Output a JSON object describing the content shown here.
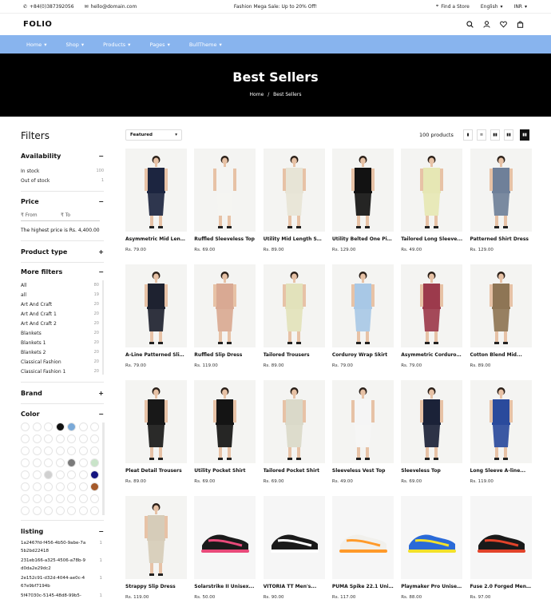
{
  "topbar": {
    "phone": "+84(0)387392056",
    "email": "hello@domain.com",
    "promo": "Fashion Mega Sale: Up to 20% Off!",
    "store": "Find a Store",
    "language": "English",
    "currency": "INR"
  },
  "brand": {
    "logo": "FOLIO"
  },
  "nav": [
    {
      "label": "Home"
    },
    {
      "label": "Shop"
    },
    {
      "label": "Products"
    },
    {
      "label": "Pages"
    },
    {
      "label": "BullTheme"
    }
  ],
  "hero": {
    "title": "Best Sellers",
    "crumb_home": "Home",
    "crumb_sep": "/",
    "crumb_current": "Best Sellers"
  },
  "filters": {
    "title": "Filters",
    "availability": {
      "label": "Availability",
      "items": [
        {
          "label": "In stock",
          "count": "100"
        },
        {
          "label": "Out of stock",
          "count": "1"
        }
      ]
    },
    "price": {
      "label": "Price",
      "from": "₹ From",
      "to": "₹ To",
      "note": "The highest price is Rs. 4,400.00"
    },
    "product_type": {
      "label": "Product type"
    },
    "more": {
      "label": "More filters",
      "items": [
        {
          "label": "All",
          "count": "80"
        },
        {
          "label": "all",
          "count": "19"
        },
        {
          "label": "Art And Craft",
          "count": "20"
        },
        {
          "label": "Art And Craft 1",
          "count": "20"
        },
        {
          "label": "Art And Craft 2",
          "count": "20"
        },
        {
          "label": "Blankets",
          "count": "20"
        },
        {
          "label": "Blankets 1",
          "count": "20"
        },
        {
          "label": "Blankets 2",
          "count": "20"
        },
        {
          "label": "Classical Fashion",
          "count": "20"
        },
        {
          "label": "Classical Fashion 1",
          "count": "20"
        }
      ]
    },
    "brand": {
      "label": "Brand"
    },
    "color": {
      "label": "Color"
    },
    "listing": {
      "label": "listing",
      "items": [
        {
          "label": "1a2467fd-f456-4b50-9abe-7a5b2bd22418",
          "count": "1"
        },
        {
          "label": "231eb166-a325-4506-a78b-9d0da2e29dc2",
          "count": "1"
        },
        {
          "label": "2e152c91-d32d-4044-ae0c-467e9bf7194b",
          "count": "1"
        },
        {
          "label": "5f47030c-5145-48d8-99b5-",
          "count": "1"
        }
      ]
    }
  },
  "toolbar": {
    "sort": "Featured",
    "count": "100 products"
  },
  "products": [
    {
      "name": "Asymmetric Mid Lengt...",
      "price": "Rs. 79.00"
    },
    {
      "name": "Ruffled Sleeveless Top",
      "price": "Rs. 69.00"
    },
    {
      "name": "Utility Mid Length Skirt",
      "price": "Rs. 89.00"
    },
    {
      "name": "Utility Belted One Piece",
      "price": "Rs. 129.00"
    },
    {
      "name": "Tailored Long Sleeve...",
      "price": "Rs. 49.00"
    },
    {
      "name": "Patterned Shirt Dress",
      "price": "Rs. 129.00"
    },
    {
      "name": "A-Line Patterned Slip...",
      "price": "Rs. 79.00"
    },
    {
      "name": "Ruffled Slip Dress",
      "price": "Rs. 119.00"
    },
    {
      "name": "Tailored Trousers",
      "price": "Rs. 89.00"
    },
    {
      "name": "Corduroy Wrap Skirt",
      "price": "Rs. 79.00"
    },
    {
      "name": "Asymmetric Corduroy...",
      "price": "Rs. 79.00"
    },
    {
      "name": "Cotton Blend Mid...",
      "price": "Rs. 89.00"
    },
    {
      "name": "Pleat Detail Trousers",
      "price": "Rs. 89.00"
    },
    {
      "name": "Utility Pocket Shirt",
      "price": "Rs. 69.00"
    },
    {
      "name": "Tailored Pocket Shirt",
      "price": "Rs. 69.00"
    },
    {
      "name": "Sleeveless Vest Top",
      "price": "Rs. 49.00"
    },
    {
      "name": "Sleeveless Top",
      "price": "Rs. 69.00"
    },
    {
      "name": "Long Sleeve A-line...",
      "price": "Rs. 119.00"
    },
    {
      "name": "Strappy Slip Dress",
      "price": "Rs. 119.00"
    },
    {
      "name": "Solarstrike II Unisex...",
      "price": "Rs. 50.00"
    },
    {
      "name": "VITORIA TT Men's...",
      "price": "Rs. 90.00"
    },
    {
      "name": "PUMA Spike 22.1 Unis...",
      "price": "Rs. 117.00"
    },
    {
      "name": "Playmaker Pro Unisex...",
      "price": "Rs. 88.00"
    },
    {
      "name": "Fuse 2.0 Forged Men's...",
      "price": "Rs. 97.00"
    }
  ],
  "colors": {
    "swatches": [
      "#ffffff",
      "#ffffff",
      "#ffffff",
      "#111111",
      "#7aa9d8",
      "#ffffff",
      "#ffffff",
      "#ffffff",
      "#ffffff",
      "#ffffff",
      "#ffffff",
      "#ffffff",
      "#ffffff",
      "#ffffff",
      "#ffffff",
      "#ffffff",
      "#ffffff",
      "#ffffff",
      "#ffffff",
      "#ffffff",
      "#ffffff",
      "#ffffff",
      "#ffffff",
      "#ffffff",
      "#ffffff",
      "#7a7a7a",
      "#ffffff",
      "#c9e4c9",
      "#ffffff",
      "#ffffff",
      "#d0d0d0",
      "#ffffff",
      "#ffffff",
      "#ffffff",
      "#161680",
      "#ffffff",
      "#ffffff",
      "#ffffff",
      "#ffffff",
      "#ffffff",
      "#ffffff",
      "#a55a2a",
      "#ffffff",
      "#ffffff",
      "#ffffff",
      "#ffffff",
      "#ffffff",
      "#ffffff",
      "#ffffff",
      "#ffffff",
      "#ffffff",
      "#ffffff",
      "#ffffff",
      "#ffffff",
      "#ffffff",
      "#ffffff"
    ],
    "garments": [
      "#1c2540",
      "#f4f4f2",
      "#e7e4d6",
      "#121212",
      "#e6e7b4",
      "#6f8099",
      "#1e2230",
      "#d9a993",
      "#e2e2bb",
      "#a8c8e6",
      "#9c3a4c",
      "#8e7555",
      "#181818",
      "#141414",
      "#dad9c9",
      "#f5f5f5",
      "#1b2238",
      "#2a4a9c",
      "#d6ccb9",
      "#1a1a1a",
      "#1a1a1a",
      "#f1f0ec",
      "#2a6ad8",
      "#1a1a1a"
    ],
    "accent": "#88b4ee"
  }
}
